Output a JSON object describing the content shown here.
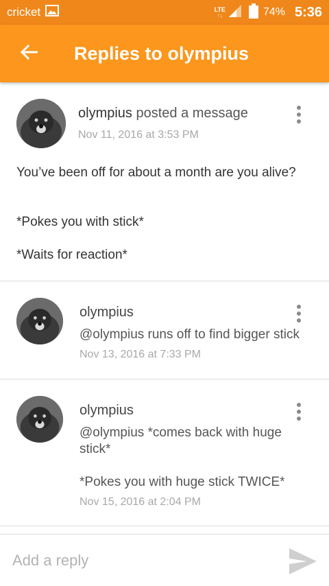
{
  "status_bar": {
    "carrier": "cricket",
    "network": "LTE",
    "battery_percent": "74%",
    "battery_level": 0.74,
    "time": "5:36",
    "icons": [
      "image-icon",
      "signal-icon",
      "battery-icon"
    ]
  },
  "app_bar": {
    "back_icon": "arrow-left-icon",
    "title": "Replies to olympius"
  },
  "post": {
    "author": "olympius",
    "verb": " posted a message",
    "timestamp": "Nov 11, 2016 at 3:53 PM",
    "body_line1": "You’ve been off for about a month are you alive?",
    "body_line2": "*Pokes you with stick*",
    "body_line3": "*Waits for reaction*"
  },
  "replies": [
    {
      "author": "olympius",
      "text": "@olympius runs off to find bigger stick",
      "timestamp": "Nov 13, 2016 at 7:33 PM"
    },
    {
      "author": "olympius",
      "text": "@olympius *comes back with huge stick*",
      "text2": "*Pokes you with huge stick TWICE*",
      "timestamp": "Nov 15, 2016 at 2:04 PM"
    }
  ],
  "reply_bar": {
    "placeholder": "Add a reply",
    "send_icon": "send-icon"
  },
  "colors": {
    "status_bar": "#f0871a",
    "app_bar": "#fc961c",
    "timestamp": "#a8a8a8"
  }
}
